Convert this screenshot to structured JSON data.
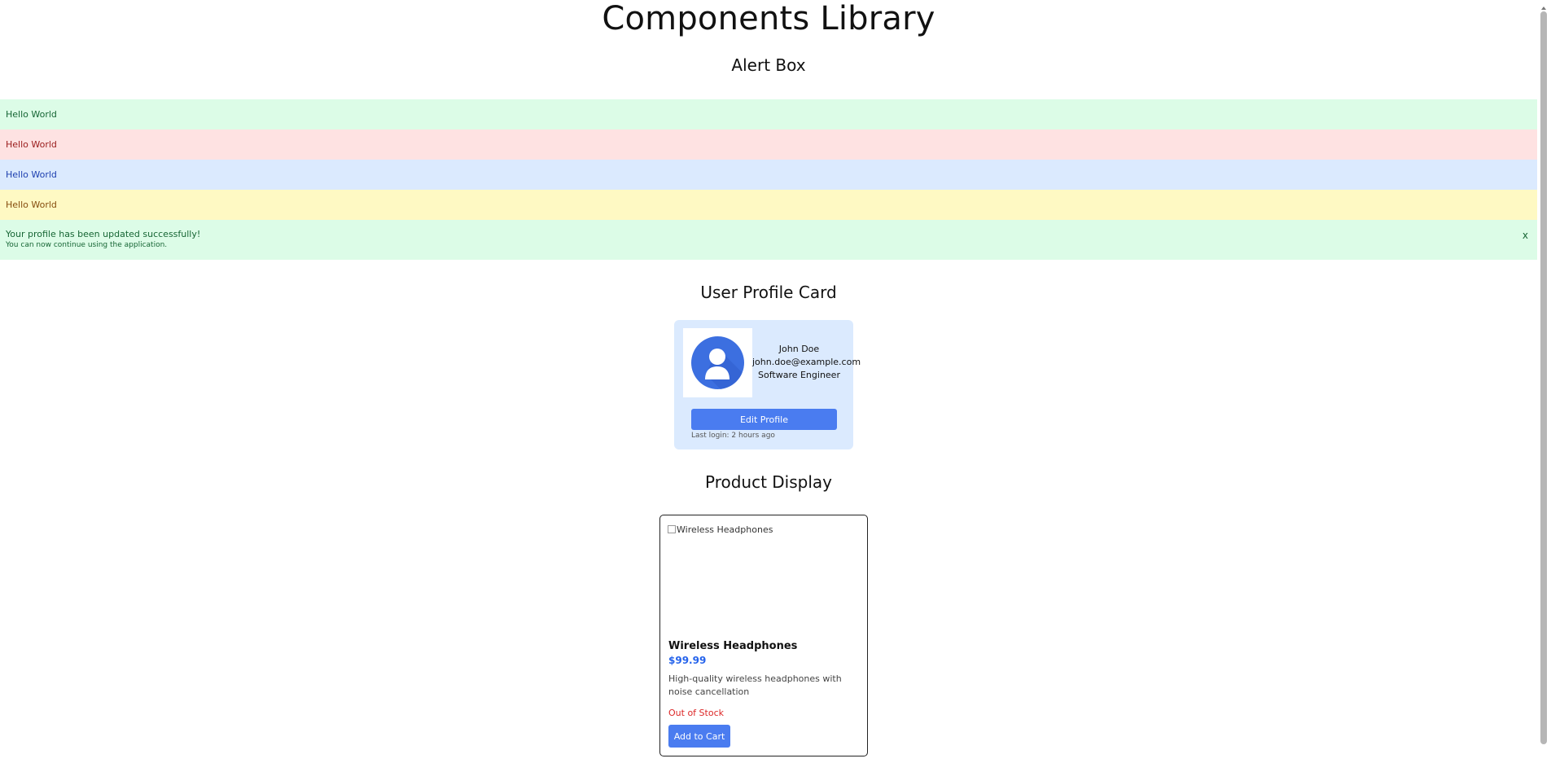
{
  "page": {
    "title": "Components Library"
  },
  "alert_section": {
    "title": "Alert Box",
    "alerts": [
      {
        "type": "success",
        "text": "Hello World"
      },
      {
        "type": "error",
        "text": "Hello World"
      },
      {
        "type": "info",
        "text": "Hello World"
      },
      {
        "type": "warning",
        "text": "Hello World"
      }
    ],
    "detailed_alert": {
      "type": "success",
      "message": "Your profile has been updated successfully!",
      "sub_message": "You can now continue using the application.",
      "close_label": "x"
    }
  },
  "profile_section": {
    "title": "User Profile Card",
    "name": "John Doe",
    "email": "john.doe@example.com",
    "role": "Software Engineer",
    "edit_label": "Edit Profile",
    "last_login": "Last login: 2 hours ago"
  },
  "product_section": {
    "title": "Product Display",
    "image_alt": "Wireless Headphones",
    "name": "Wireless Headphones",
    "price": "$99.99",
    "description": "High-quality wireless headphones with noise cancellation",
    "stock_status": "Out of Stock",
    "cart_label": "Add to Cart"
  },
  "colors": {
    "success_bg": "#dcfce7",
    "error_bg": "#fee2e2",
    "info_bg": "#dbeafe",
    "warning_bg": "#fef9c3",
    "primary_button": "#4a7cf0",
    "price": "#2563eb",
    "out_of_stock": "#dc2626"
  },
  "icons": {
    "avatar": "user-avatar-icon",
    "broken_image": "broken-image-icon"
  }
}
